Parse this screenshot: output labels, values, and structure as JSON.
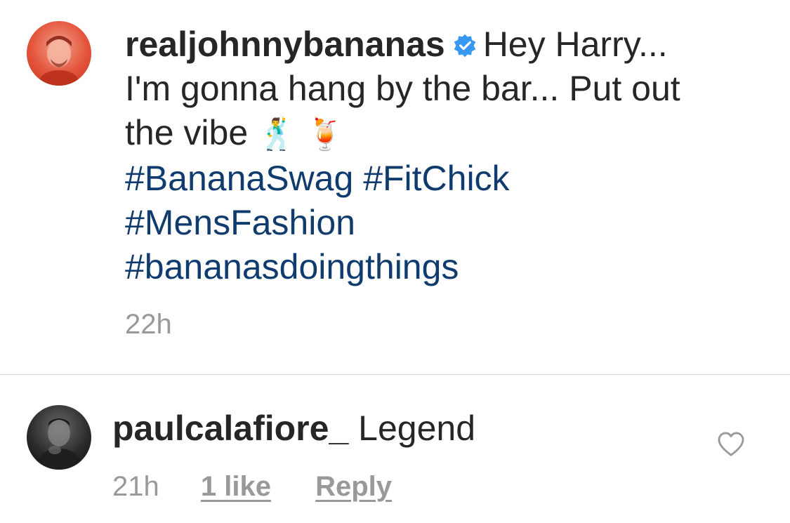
{
  "caption": {
    "username": "realjohnnybananas",
    "verified_icon": "verified-badge-icon",
    "text": "Hey Harry... I'm gonna hang by the bar... Put out the vibe",
    "emojis": [
      "🕺",
      "🍹"
    ],
    "hashtags": [
      "#BananaSwag",
      "#FitChick",
      "#MensFashion",
      "#bananasdoingthings"
    ],
    "time": "22h"
  },
  "comment": {
    "username": "paulcalafiore_",
    "text": "Legend",
    "time": "21h",
    "likes_label": "1 like",
    "reply_label": "Reply",
    "like_icon": "heart-icon"
  },
  "colors": {
    "text": "#262626",
    "hashtag": "#0f3b6e",
    "muted": "#999999",
    "verified": "#3897f0",
    "divider": "#dbdbdb"
  }
}
